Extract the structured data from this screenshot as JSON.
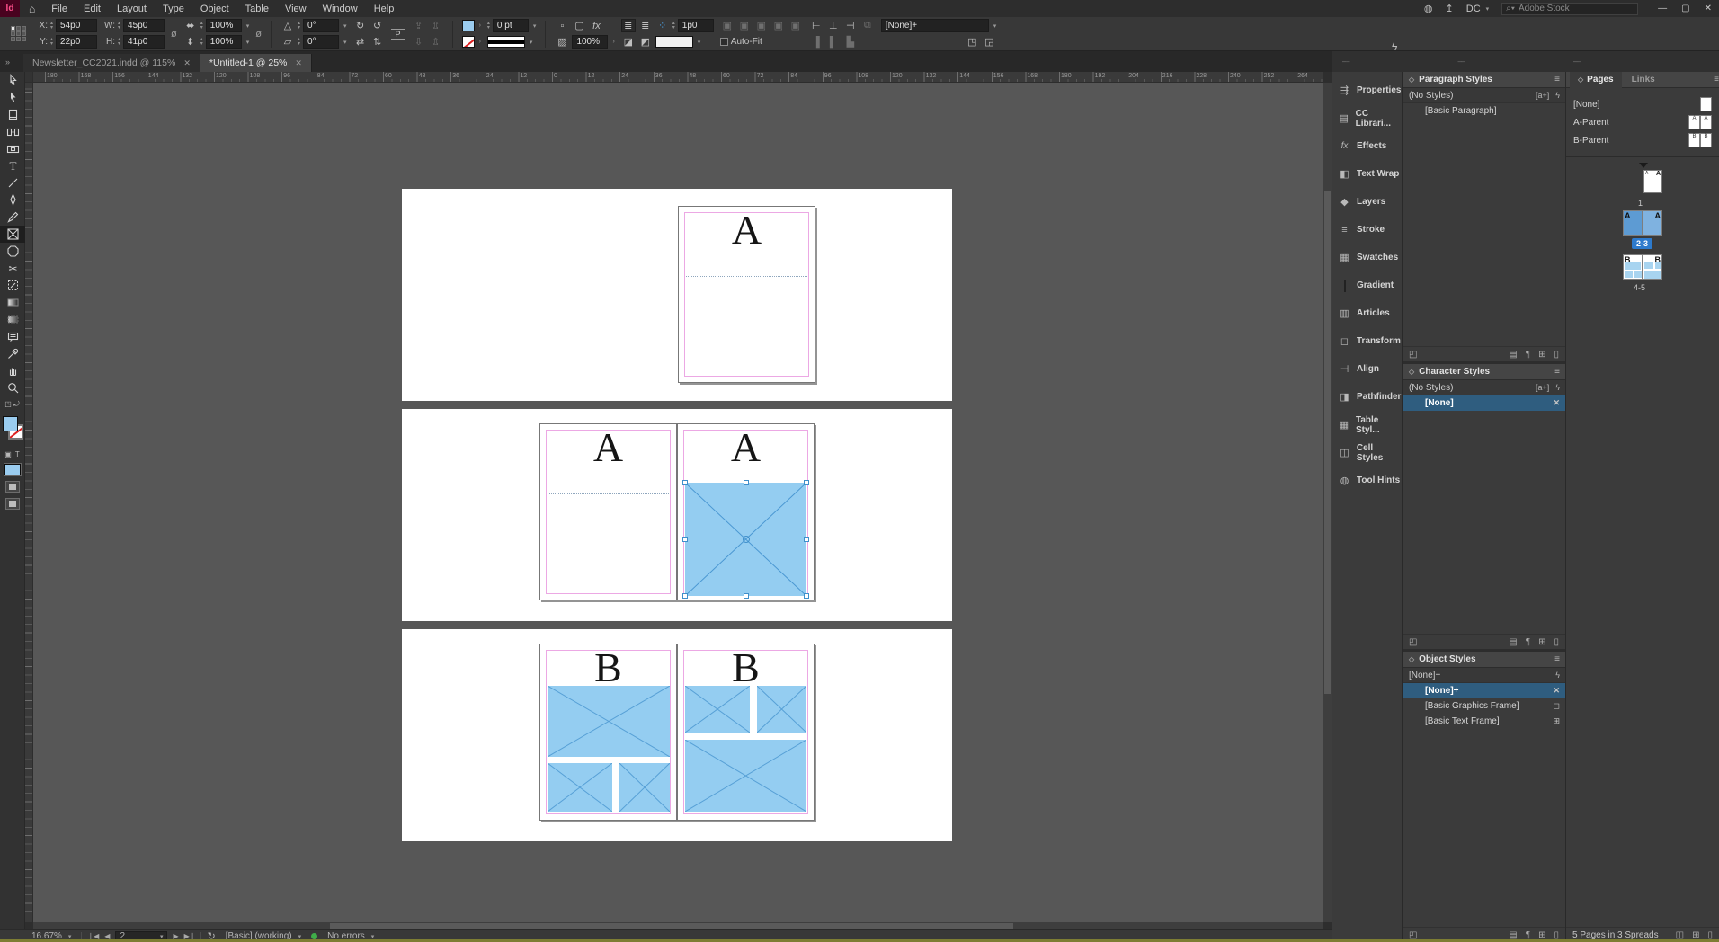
{
  "app": {
    "logo_text": "Id",
    "menus": [
      "File",
      "Edit",
      "Layout",
      "Type",
      "Object",
      "Table",
      "View",
      "Window",
      "Help"
    ],
    "workspace_switcher": "DC",
    "stock_search_placeholder": "Adobe Stock"
  },
  "control_panel": {
    "x_label": "X:",
    "x_value": "54p0",
    "y_label": "Y:",
    "y_value": "22p0",
    "w_label": "W:",
    "w_value": "45p0",
    "h_label": "H:",
    "h_value": "41p0",
    "scale_x": "100%",
    "scale_y": "100%",
    "rotation": "0°",
    "shear": "0°",
    "stroke_weight": "0 pt",
    "effects_opacity": "100%",
    "corner_radius": "1p0",
    "content_grabber": "P",
    "fx_label": "fx",
    "auto_fit_label": "Auto-Fit",
    "object_style_value": "[None]+"
  },
  "document_tabs": [
    {
      "title": "Newsletter_CC2021.indd @ 115%",
      "active": false
    },
    {
      "title": "*Untitled-1 @ 25%",
      "active": true
    }
  ],
  "ruler_labels": [
    "180",
    "168",
    "156",
    "144",
    "132",
    "120",
    "108",
    "96",
    "84",
    "72",
    "60",
    "48",
    "36",
    "24",
    "12",
    "0",
    "12",
    "24",
    "36",
    "48",
    "60",
    "72",
    "84",
    "96",
    "108",
    "120",
    "132",
    "144",
    "156",
    "168",
    "180",
    "192",
    "204",
    "216",
    "228",
    "240",
    "252",
    "264"
  ],
  "tools": [
    {
      "name": "selection-tool"
    },
    {
      "name": "direct-selection-tool"
    },
    {
      "name": "page-tool"
    },
    {
      "name": "gap-tool"
    },
    {
      "name": "content-collector-tool"
    },
    {
      "name": "type-tool"
    },
    {
      "name": "line-tool"
    },
    {
      "name": "pen-tool"
    },
    {
      "name": "pencil-tool"
    },
    {
      "name": "rectangle-frame-tool",
      "selected": true
    },
    {
      "name": "rectangle-tool"
    },
    {
      "name": "scissors-tool"
    },
    {
      "name": "free-transform-tool"
    },
    {
      "name": "gradient-swatch-tool"
    },
    {
      "name": "gradient-feather-tool"
    },
    {
      "name": "note-tool"
    },
    {
      "name": "eyedropper-tool"
    },
    {
      "name": "hand-tool"
    },
    {
      "name": "zoom-tool"
    }
  ],
  "panel_dock": [
    {
      "label": "Properties",
      "icon": "properties-icon"
    },
    {
      "label": "CC Librari...",
      "icon": "cc-libraries-icon"
    },
    {
      "label": "Effects",
      "icon": "effects-icon"
    },
    {
      "label": "Text Wrap",
      "icon": "text-wrap-icon"
    },
    {
      "label": "Layers",
      "icon": "layers-icon"
    },
    {
      "label": "Stroke",
      "icon": "stroke-icon"
    },
    {
      "label": "Swatches",
      "icon": "swatches-icon"
    },
    {
      "label": "Gradient",
      "icon": "gradient-icon"
    },
    {
      "label": "Articles",
      "icon": "articles-icon"
    },
    {
      "label": "Transform",
      "icon": "transform-icon"
    },
    {
      "label": "Align",
      "icon": "align-icon"
    },
    {
      "label": "Pathfinder",
      "icon": "pathfinder-icon"
    },
    {
      "label": "Table Styl...",
      "icon": "table-styles-icon"
    },
    {
      "label": "Cell Styles",
      "icon": "cell-styles-icon"
    },
    {
      "label": "Tool Hints",
      "icon": "tool-hints-icon"
    }
  ],
  "styles_panels": {
    "paragraph": {
      "title": "Paragraph Styles",
      "quick_row": "(No Styles)",
      "badge": "[a+]",
      "items": [
        {
          "label": "[Basic Paragraph]",
          "selected": false,
          "icon": ""
        }
      ]
    },
    "character": {
      "title": "Character Styles",
      "quick_row": "(No Styles)",
      "badge": "[a+]",
      "items": [
        {
          "label": "[None]",
          "selected": true,
          "icon": "no-edit"
        }
      ]
    },
    "object": {
      "title": "Object Styles",
      "quick_row": "[None]+",
      "badge": "",
      "items": [
        {
          "label": "[None]+",
          "selected": true,
          "icon": "no-edit"
        },
        {
          "label": "[Basic Graphics Frame]",
          "selected": false,
          "icon": "graphics-frame"
        },
        {
          "label": "[Basic Text Frame]",
          "selected": false,
          "icon": "text-frame"
        }
      ]
    }
  },
  "pages_panel": {
    "tabs": [
      {
        "label": "Pages",
        "active": true
      },
      {
        "label": "Links",
        "active": false
      }
    ],
    "masters": [
      {
        "name": "[None]",
        "letter": "",
        "pages": 1
      },
      {
        "name": "A-Parent",
        "letter": "A",
        "pages": 2
      },
      {
        "name": "B-Parent",
        "letter": "B",
        "pages": 2
      }
    ],
    "spreads": [
      {
        "label": "1",
        "letter": "A",
        "pages": 1,
        "selected": false,
        "current": true
      },
      {
        "label": "2-3",
        "letter": "A",
        "pages": 2,
        "selected": true,
        "current": false
      },
      {
        "label": "4-5",
        "letter": "B",
        "pages": 2,
        "selected": false,
        "current": false
      }
    ],
    "footer": "5 Pages in 3 Spreads"
  },
  "canvas": {
    "spreads": [
      {
        "letter": "A"
      },
      {
        "letter": "A"
      },
      {
        "letter": "B"
      }
    ]
  },
  "status_bar": {
    "zoom_level": "16.67%",
    "page_number": "2",
    "preflight_profile": "[Basic] (working)",
    "preflight_status": "No errors"
  },
  "colors": {
    "frame_fill": "#94CDF1",
    "frame_stroke": "#4A97D2",
    "margin_guide": "#ECA8E4",
    "selection_highlight": "#2F5D7F",
    "pages_badge": "#2D7ACC"
  }
}
